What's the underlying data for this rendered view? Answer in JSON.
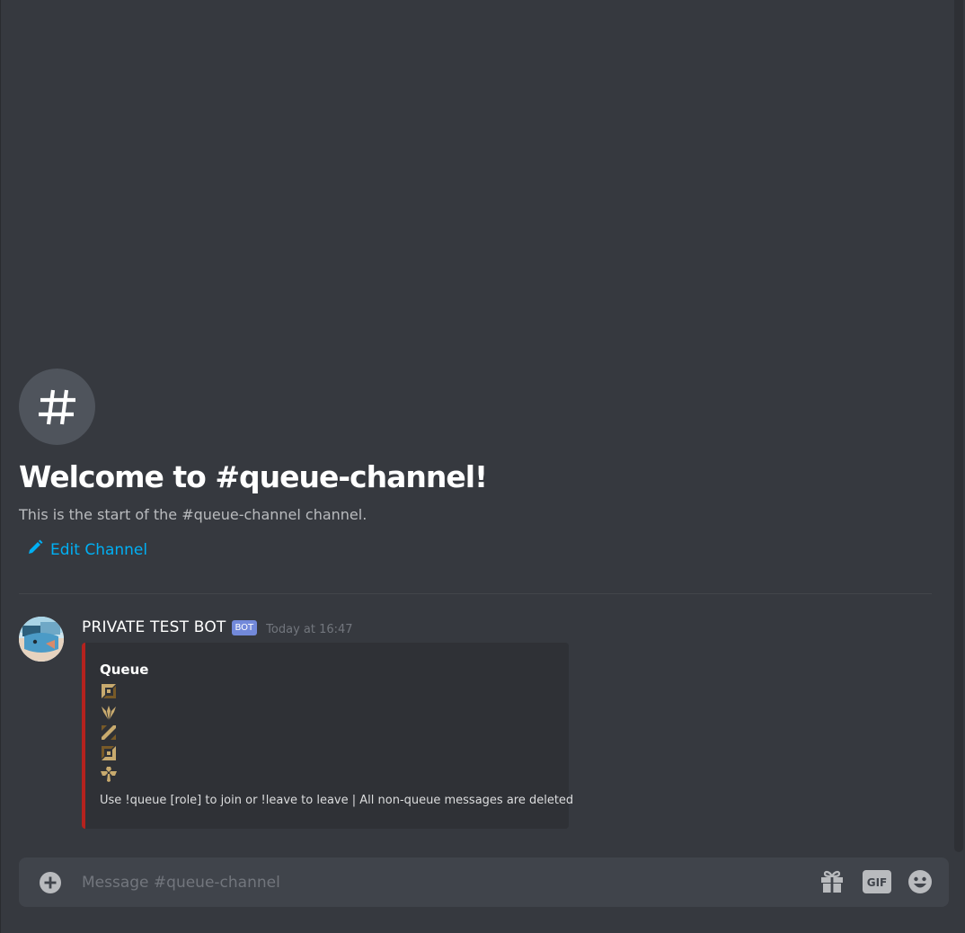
{
  "channel": {
    "name": "queue-channel",
    "welcome_title": "Welcome to #queue-channel!",
    "welcome_subtitle": "This is the start of the #queue-channel channel.",
    "edit_label": "Edit Channel"
  },
  "message": {
    "author": "PRIVATE TEST BOT",
    "tag": "BOT",
    "timestamp": "Today at 16:47",
    "embed": {
      "accent_color": "#b5221e",
      "title": "Queue",
      "role_icons": [
        "top-lane-icon",
        "jungle-icon",
        "mid-lane-icon",
        "bottom-lane-icon",
        "support-icon"
      ],
      "description": "Use !queue [role] to join or !leave to leave | All non-queue messages are deleted"
    }
  },
  "composer": {
    "placeholder": "Message #queue-channel",
    "gif_label": "GIF"
  },
  "colors": {
    "background": "#36393f",
    "link": "#00b0f4",
    "bot_tag": "#7289da",
    "role_icon": "#c8aa6e"
  }
}
